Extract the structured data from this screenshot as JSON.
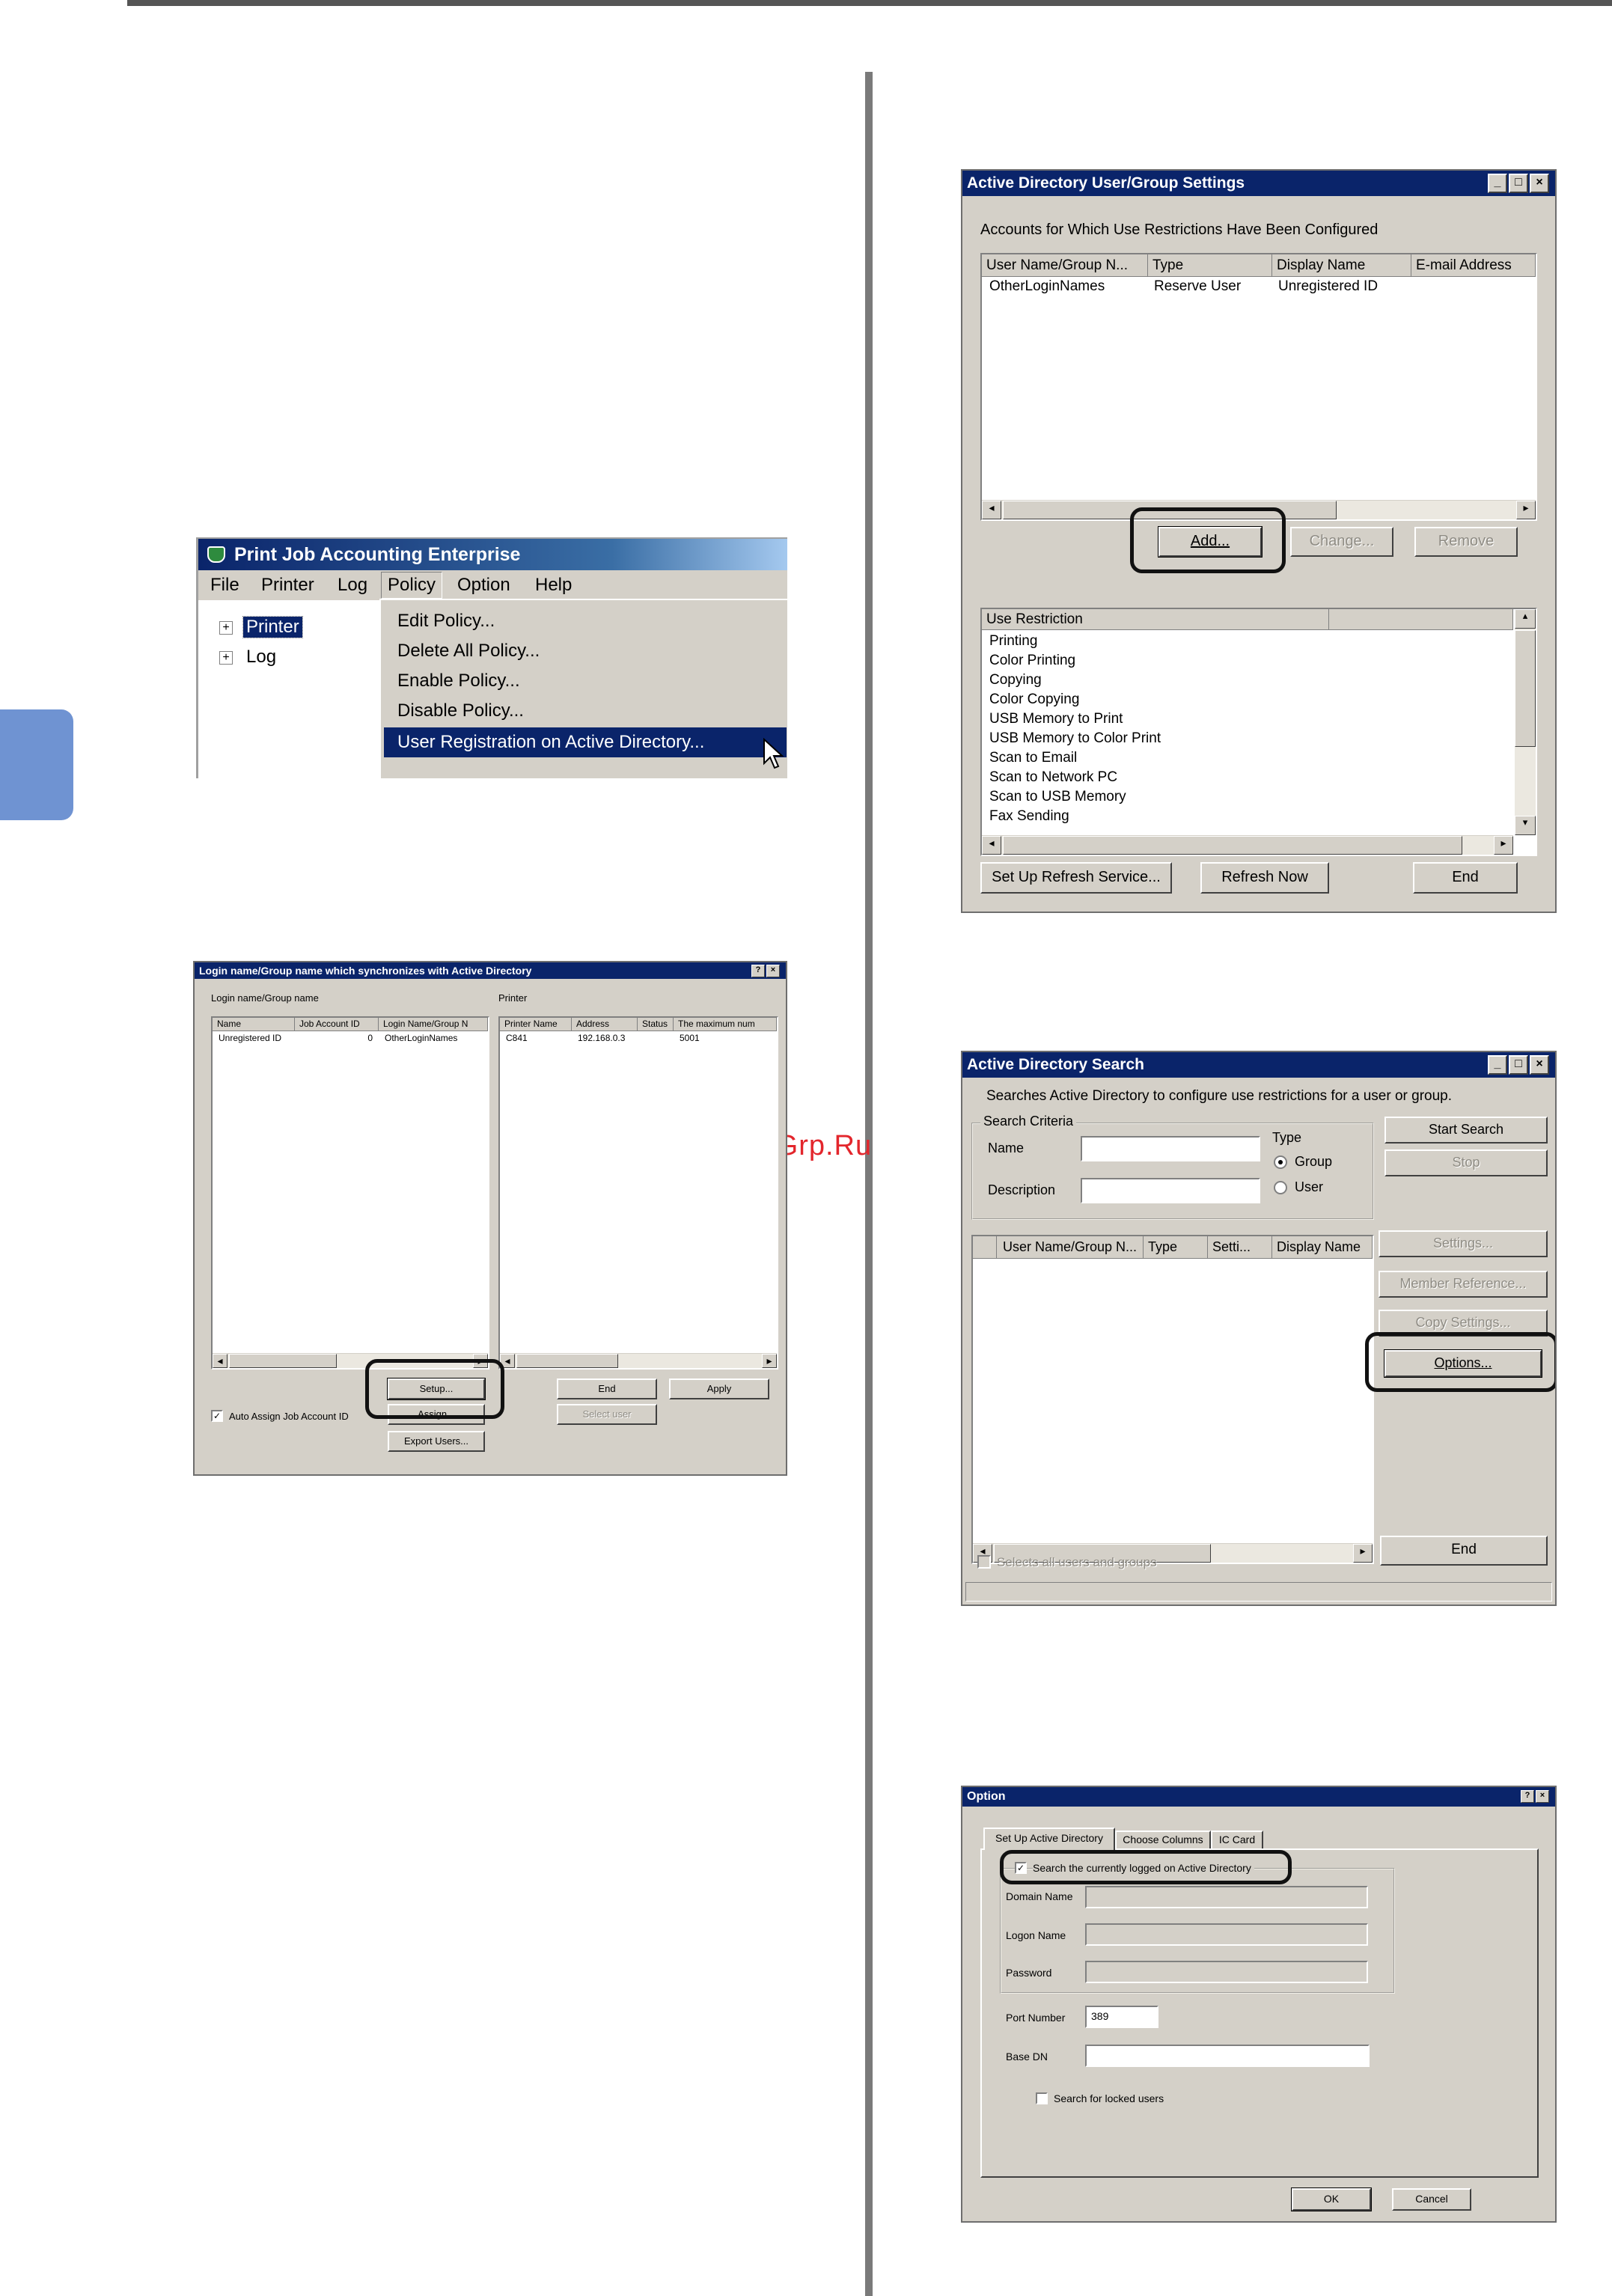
{
  "watermark": "McGrp.Ru",
  "pje": {
    "title": "Print Job Accounting Enterprise",
    "menu": [
      "File",
      "Printer",
      "Log",
      "Policy",
      "Option",
      "Help"
    ],
    "tree": [
      "Printer",
      "Log"
    ],
    "policy_menu": [
      "Edit Policy...",
      "Delete All Policy...",
      "Enable Policy...",
      "Disable Policy...",
      "User Registration on Active Directory..."
    ]
  },
  "login": {
    "title": "Login name/Group name which synchronizes with Active Directory",
    "title_buttons": [
      "?",
      "×"
    ],
    "left_label": "Login name/Group name",
    "right_label": "Printer",
    "left_columns": [
      "Name",
      "Job Account ID",
      "Login Name/Group N"
    ],
    "left_row": [
      "Unregistered ID",
      "0",
      "OtherLoginNames"
    ],
    "right_columns": [
      "Printer Name",
      "Address",
      "Status",
      "The maximum num"
    ],
    "right_row": [
      "C841",
      "192.168.0.3",
      "",
      "5001"
    ],
    "setup_button": "Setup...",
    "assign_button": "Assign...",
    "export_button": "Export Users...",
    "end_button": "End",
    "apply_button": "Apply",
    "select_user_button": "Select user",
    "auto_assign_label": "Auto Assign Job Account ID"
  },
  "adug": {
    "title": "Active Directory User/Group Settings",
    "title_buttons": [
      "_",
      "□",
      "×"
    ],
    "accounts_label": "Accounts for Which Use Restrictions Have Been Configured",
    "columns": [
      "User Name/Group N...",
      "Type",
      "Display Name",
      "E-mail Address"
    ],
    "row": [
      "OtherLoginNames",
      "Reserve User",
      "Unregistered ID",
      ""
    ],
    "add_button": "Add...",
    "change_button": "Change...",
    "remove_button": "Remove",
    "restriction_header": "Use Restriction",
    "restrictions": [
      "Printing",
      "Color Printing",
      "Copying",
      "Color Copying",
      "USB Memory to Print",
      "USB Memory to Color Print",
      "Scan to Email",
      "Scan to Network PC",
      "Scan to USB Memory",
      "Fax Sending"
    ],
    "refresh_service_button": "Set Up Refresh Service...",
    "refresh_now_button": "Refresh Now",
    "end_button": "End"
  },
  "ads": {
    "title": "Active Directory Search",
    "title_buttons": [
      "_",
      "□",
      "×"
    ],
    "description": "Searches Active Directory to configure use restrictions for a user or group.",
    "criteria_label": "Search Criteria",
    "name_label": "Name",
    "description_label": "Description",
    "name_value": "",
    "description_value": "",
    "type_label": "Type",
    "type_options": [
      "Group",
      "User"
    ],
    "type_selected": "Group",
    "start_button": "Start Search",
    "stop_button": "Stop",
    "columns": [
      "",
      "User Name/Group N...",
      "Type",
      "Setti...",
      "Display Name"
    ],
    "settings_button": "Settings...",
    "member_button": "Member Reference...",
    "copy_button": "Copy Settings...",
    "options_button": "Options...",
    "end_button": "End",
    "select_all_label": "Selects all users and groups"
  },
  "opt": {
    "title": "Option",
    "title_buttons": [
      "?",
      "×"
    ],
    "tabs": [
      "Set Up Active Directory",
      "Choose Columns",
      "IC Card"
    ],
    "search_logged_label": "Search the currently logged on Active Directory",
    "domain_label": "Domain Name",
    "logon_label": "Logon Name",
    "password_label": "Password",
    "port_label": "Port Number",
    "port_value": "389",
    "basedn_label": "Base DN",
    "basedn_value": "",
    "locked_label": "Search for locked users",
    "ok_button": "OK",
    "cancel_button": "Cancel"
  }
}
